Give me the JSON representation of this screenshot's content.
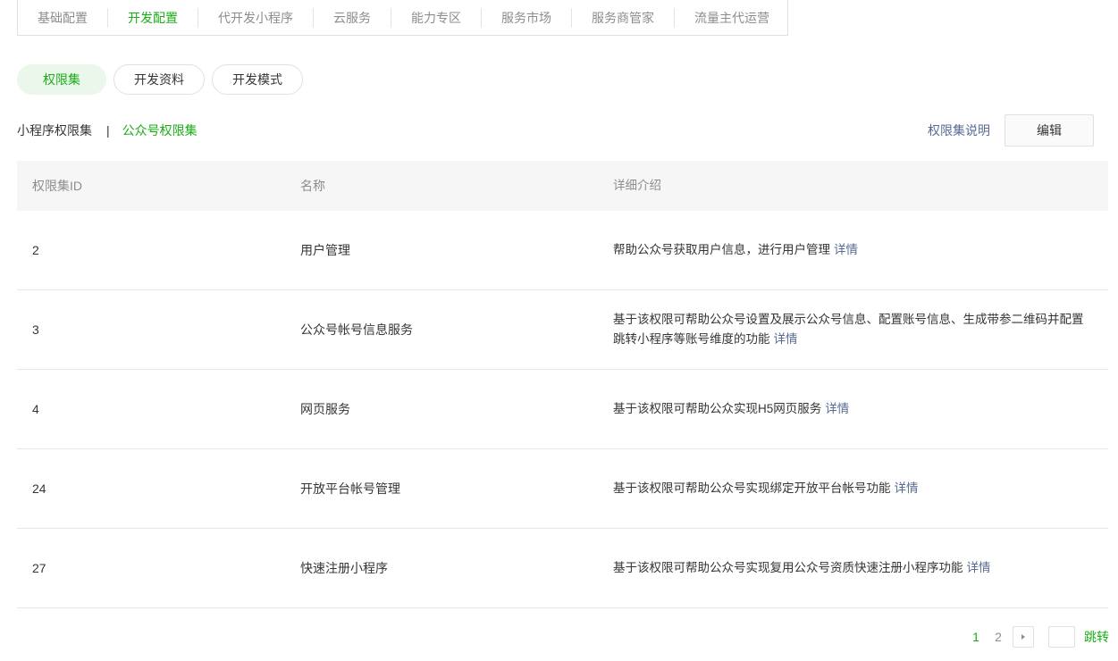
{
  "topnav": {
    "items": [
      {
        "label": "基础配置",
        "active": false
      },
      {
        "label": "开发配置",
        "active": true
      },
      {
        "label": "代开发小程序",
        "active": false
      },
      {
        "label": "云服务",
        "active": false
      },
      {
        "label": "能力专区",
        "active": false
      },
      {
        "label": "服务市场",
        "active": false
      },
      {
        "label": "服务商管家",
        "active": false
      },
      {
        "label": "流量主代运营",
        "active": false
      }
    ]
  },
  "pills": [
    {
      "label": "权限集",
      "active": true
    },
    {
      "label": "开发资料",
      "active": false
    },
    {
      "label": "开发模式",
      "active": false
    }
  ],
  "subtabs": {
    "mini_program": "小程序权限集",
    "separator": "|",
    "official_account": "公众号权限集"
  },
  "actions": {
    "explain": "权限集说明",
    "edit": "编辑"
  },
  "table": {
    "headers": {
      "id": "权限集ID",
      "name": "名称",
      "desc": "详细介绍"
    },
    "detail_label": "详情",
    "rows": [
      {
        "id": "2",
        "name": "用户管理",
        "desc": "帮助公众号获取用户信息，进行用户管理"
      },
      {
        "id": "3",
        "name": "公众号帐号信息服务",
        "desc": "基于该权限可帮助公众号设置及展示公众号信息、配置账号信息、生成带参二维码并配置跳转小程序等账号维度的功能"
      },
      {
        "id": "4",
        "name": "网页服务",
        "desc": "基于该权限可帮助公众实现H5网页服务"
      },
      {
        "id": "24",
        "name": "开放平台帐号管理",
        "desc": "基于该权限可帮助公众号实现绑定开放平台帐号功能"
      },
      {
        "id": "27",
        "name": "快速注册小程序",
        "desc": "基于该权限可帮助公众号实现复用公众号资质快速注册小程序功能"
      }
    ]
  },
  "pagination": {
    "pages": [
      "1",
      "2"
    ],
    "current": "1",
    "jump": "跳转",
    "input_value": ""
  },
  "colors": {
    "accent": "#1aad19",
    "link": "#576b95",
    "muted": "#8d8d8d"
  }
}
